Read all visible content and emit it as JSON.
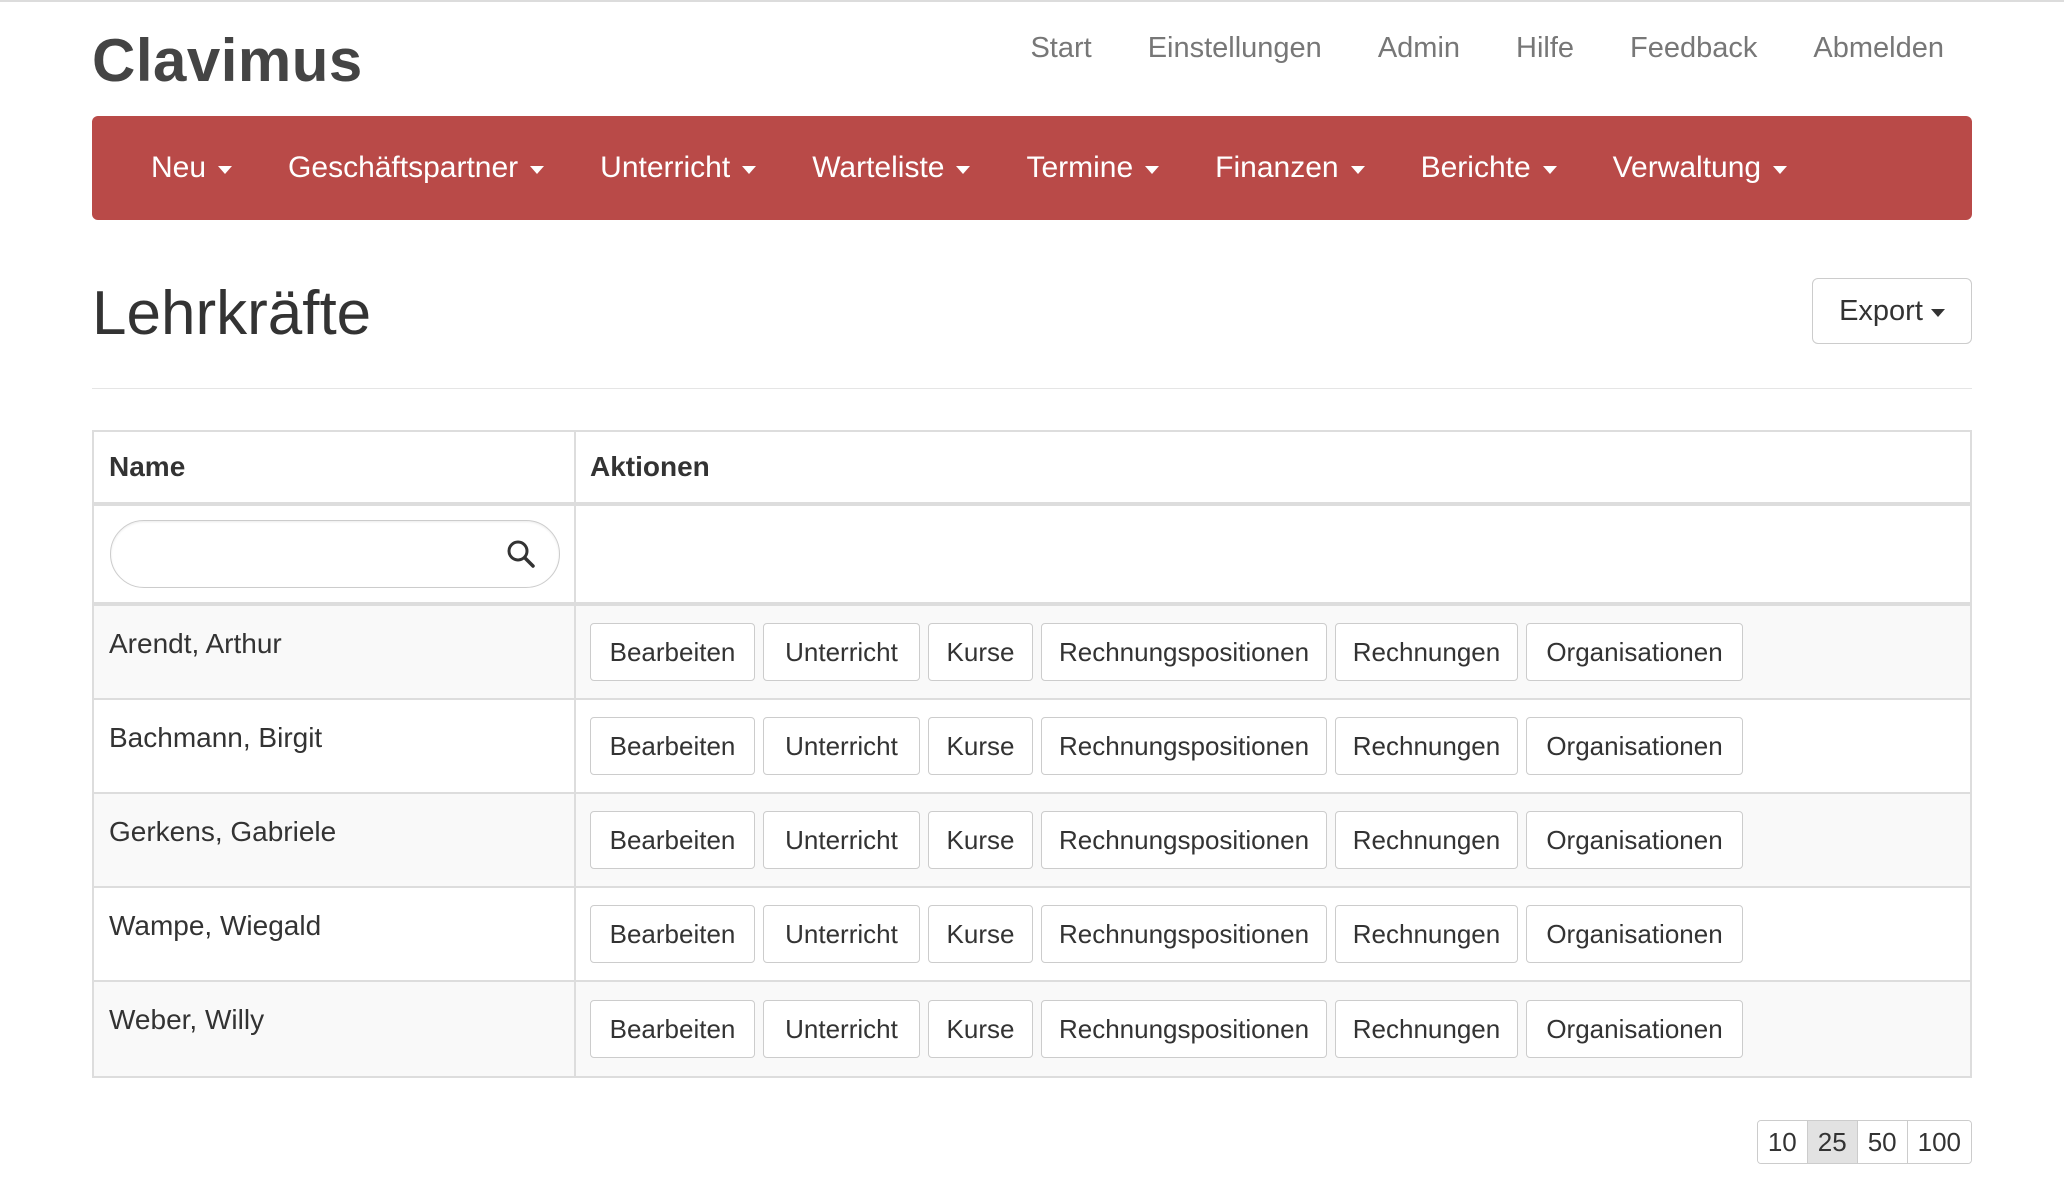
{
  "app": {
    "brand": "Clavimus"
  },
  "top_links": [
    {
      "label": "Start",
      "name": "top-link-start"
    },
    {
      "label": "Einstellungen",
      "name": "top-link-einstellungen"
    },
    {
      "label": "Admin",
      "name": "top-link-admin"
    },
    {
      "label": "Hilfe",
      "name": "top-link-hilfe"
    },
    {
      "label": "Feedback",
      "name": "top-link-feedback"
    },
    {
      "label": "Abmelden",
      "name": "top-link-abmelden"
    }
  ],
  "navbar": {
    "color": "#b94a48",
    "items": [
      {
        "label": "Neu"
      },
      {
        "label": "Geschäftspartner"
      },
      {
        "label": "Unterricht"
      },
      {
        "label": "Warteliste"
      },
      {
        "label": "Termine"
      },
      {
        "label": "Finanzen"
      },
      {
        "label": "Berichte"
      },
      {
        "label": "Verwaltung"
      }
    ]
  },
  "page": {
    "title": "Lehrkräfte",
    "export_label": "Export"
  },
  "table": {
    "headers": {
      "name": "Name",
      "actions": "Aktionen"
    },
    "search": {
      "value": "",
      "placeholder": ""
    },
    "action_labels": [
      "Bearbeiten",
      "Unterricht",
      "Kurse",
      "Rechnungspositionen",
      "Rechnungen",
      "Organisationen"
    ],
    "rows": [
      {
        "name": "Arendt, Arthur"
      },
      {
        "name": "Bachmann, Birgit"
      },
      {
        "name": "Gerkens, Gabriele"
      },
      {
        "name": "Wampe, Wiegald"
      },
      {
        "name": "Weber, Willy"
      }
    ]
  },
  "pagination": {
    "options": [
      "10",
      "25",
      "50",
      "100"
    ],
    "selected": "25"
  }
}
